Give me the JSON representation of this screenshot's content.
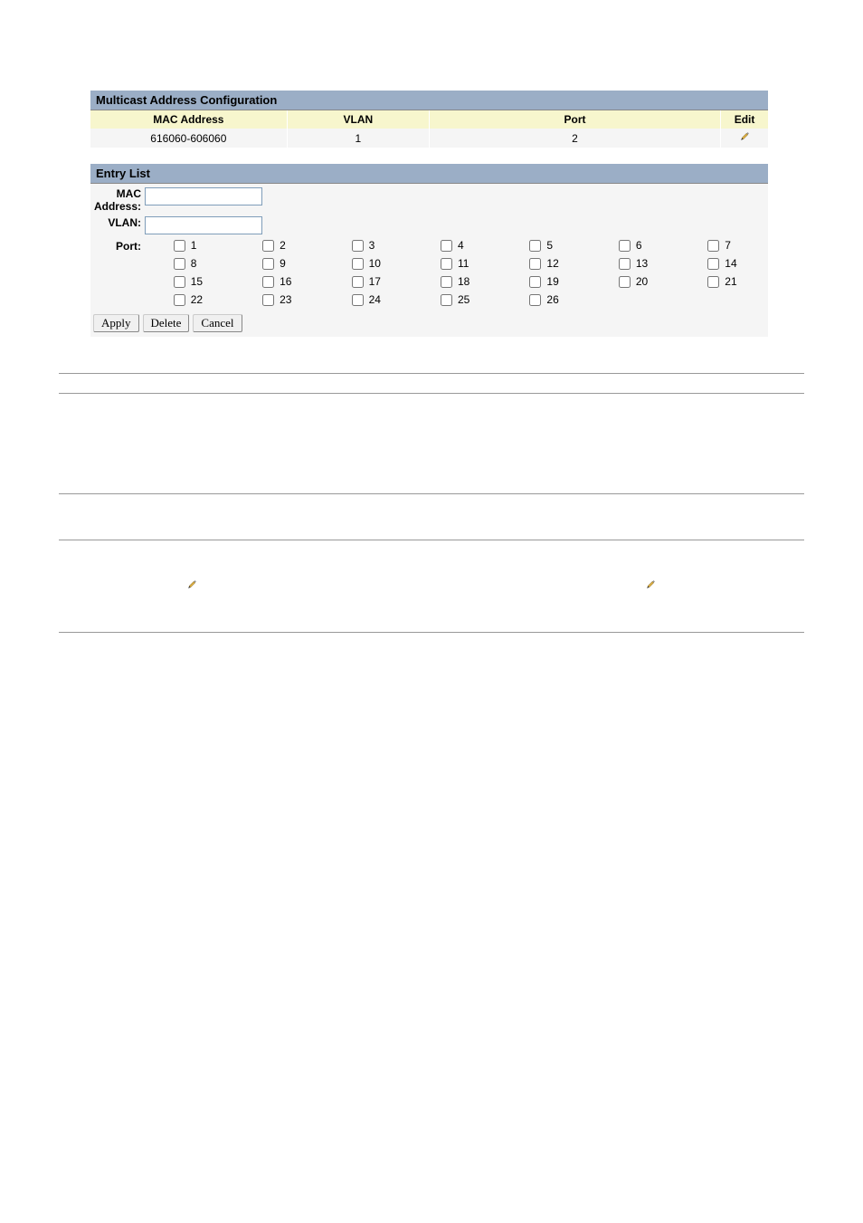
{
  "config": {
    "title": "Multicast Address Configuration",
    "headers": {
      "mac": "MAC Address",
      "vlan": "VLAN",
      "port": "Port",
      "edit": "Edit"
    },
    "rows": [
      {
        "mac": "616060-606060",
        "vlan": "1",
        "port": "2"
      }
    ]
  },
  "entry": {
    "title": "Entry List",
    "labels": {
      "mac": "MAC Address:",
      "vlan": "VLAN:",
      "port": "Port:"
    },
    "values": {
      "mac": "",
      "vlan": ""
    },
    "ports": [
      {
        "n": "1",
        "c": false
      },
      {
        "n": "2",
        "c": false
      },
      {
        "n": "3",
        "c": false
      },
      {
        "n": "4",
        "c": false
      },
      {
        "n": "5",
        "c": false
      },
      {
        "n": "6",
        "c": false
      },
      {
        "n": "7",
        "c": false
      },
      {
        "n": "8",
        "c": false
      },
      {
        "n": "9",
        "c": false
      },
      {
        "n": "10",
        "c": false
      },
      {
        "n": "11",
        "c": false
      },
      {
        "n": "12",
        "c": false
      },
      {
        "n": "13",
        "c": false
      },
      {
        "n": "14",
        "c": false
      },
      {
        "n": "15",
        "c": false
      },
      {
        "n": "16",
        "c": false
      },
      {
        "n": "17",
        "c": false
      },
      {
        "n": "18",
        "c": false
      },
      {
        "n": "19",
        "c": false
      },
      {
        "n": "20",
        "c": false
      },
      {
        "n": "21",
        "c": false
      },
      {
        "n": "22",
        "c": false
      },
      {
        "n": "23",
        "c": false
      },
      {
        "n": "24",
        "c": false
      },
      {
        "n": "25",
        "c": false
      },
      {
        "n": "26",
        "c": false
      }
    ],
    "buttons": {
      "apply": "Apply",
      "delete": "Delete",
      "cancel": "Cancel"
    }
  }
}
